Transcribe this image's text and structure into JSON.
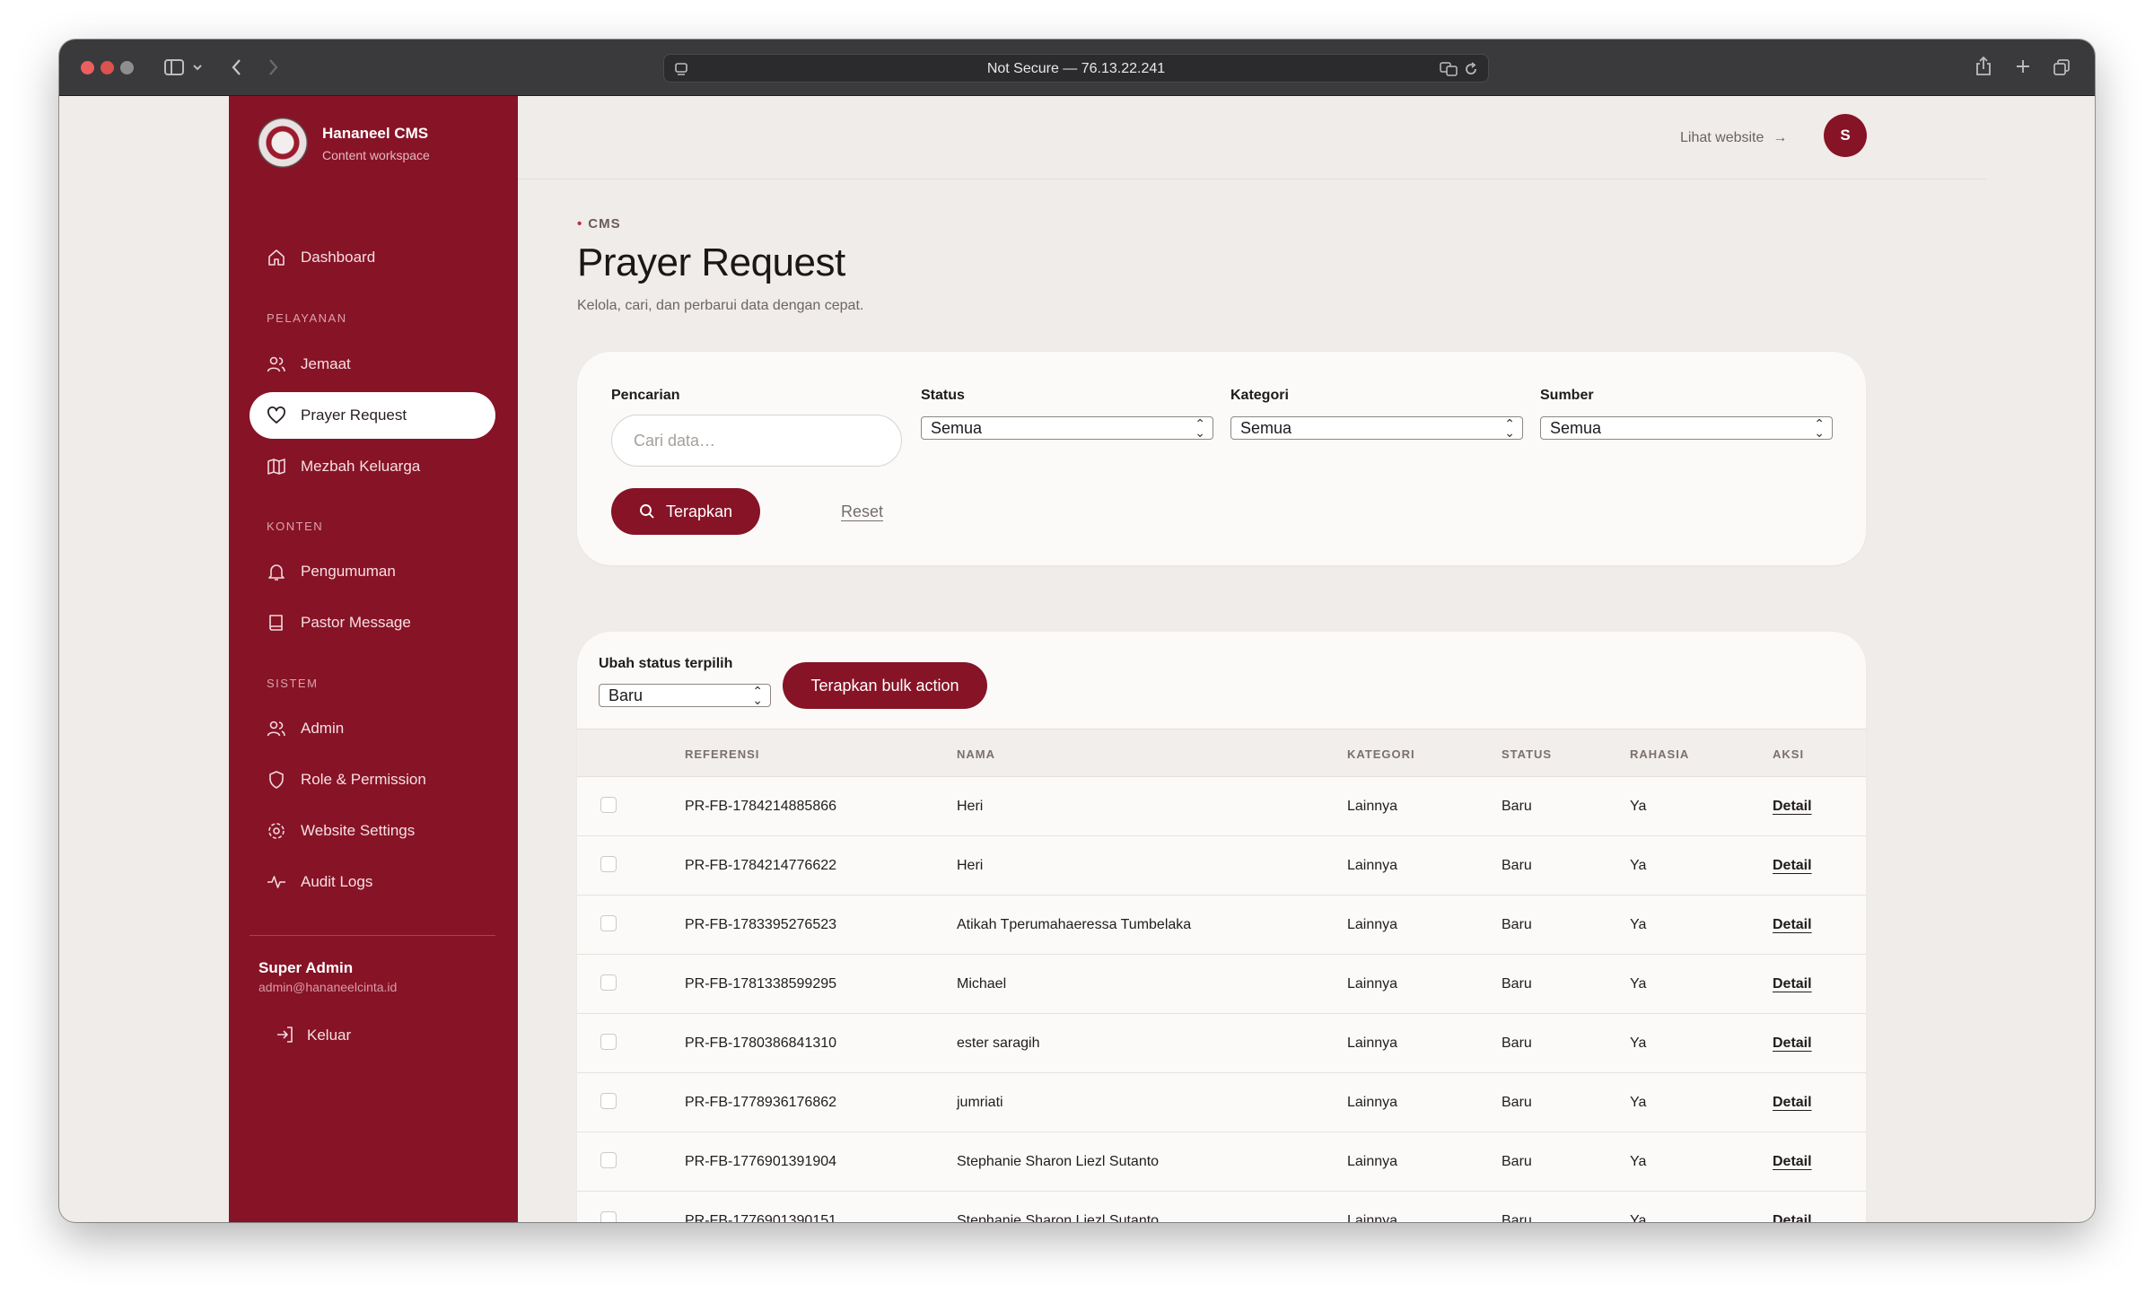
{
  "browser": {
    "url": "Not Secure — 76.13.22.241"
  },
  "brand": {
    "title": "Hananeel CMS",
    "subtitle": "Content workspace"
  },
  "sidebar": {
    "dashboard": "Dashboard",
    "sections": [
      "PELAYANAN",
      "KONTEN",
      "SISTEM"
    ],
    "items": [
      {
        "label": "Jemaat",
        "icon": "users-icon"
      },
      {
        "label": "Prayer Request",
        "icon": "heart-icon",
        "active": true
      },
      {
        "label": "Mezbah Keluarga",
        "icon": "map-icon"
      },
      {
        "label": "Pengumuman",
        "icon": "bell-icon"
      },
      {
        "label": "Pastor Message",
        "icon": "book-icon"
      },
      {
        "label": "Admin",
        "icon": "users-icon"
      },
      {
        "label": "Role & Permission",
        "icon": "shield-icon"
      },
      {
        "label": "Website Settings",
        "icon": "gear-icon"
      },
      {
        "label": "Audit Logs",
        "icon": "activity-icon"
      }
    ],
    "user": {
      "name": "Super Admin",
      "email": "admin@hananeelcinta.id"
    },
    "logout": "Keluar"
  },
  "topbar": {
    "view_site": "Lihat website",
    "avatar_initial": "S"
  },
  "page": {
    "breadcrumb": "CMS",
    "title": "Prayer Request",
    "description": "Kelola, cari, dan perbarui data dengan cepat."
  },
  "filters": {
    "search_label": "Pencarian",
    "search_placeholder": "Cari data…",
    "status_label": "Status",
    "status_value": "Semua",
    "category_label": "Kategori",
    "category_value": "Semua",
    "source_label": "Sumber",
    "source_value": "Semua",
    "apply": "Terapkan",
    "reset": "Reset"
  },
  "bulk": {
    "label": "Ubah status terpilih",
    "value": "Baru",
    "apply": "Terapkan bulk action"
  },
  "table": {
    "headers": [
      "REFERENSI",
      "NAMA",
      "KATEGORI",
      "STATUS",
      "RAHASIA",
      "AKSI"
    ],
    "rows": [
      {
        "ref": "PR-FB-1784214885866",
        "name": "Heri",
        "category": "Lainnya",
        "status": "Baru",
        "secret": "Ya",
        "action": "Detail"
      },
      {
        "ref": "PR-FB-1784214776622",
        "name": "Heri",
        "category": "Lainnya",
        "status": "Baru",
        "secret": "Ya",
        "action": "Detail"
      },
      {
        "ref": "PR-FB-1783395276523",
        "name": "Atikah Tperumahaeressa Tumbelaka",
        "category": "Lainnya",
        "status": "Baru",
        "secret": "Ya",
        "action": "Detail"
      },
      {
        "ref": "PR-FB-1781338599295",
        "name": "Michael",
        "category": "Lainnya",
        "status": "Baru",
        "secret": "Ya",
        "action": "Detail"
      },
      {
        "ref": "PR-FB-1780386841310",
        "name": "ester saragih",
        "category": "Lainnya",
        "status": "Baru",
        "secret": "Ya",
        "action": "Detail"
      },
      {
        "ref": "PR-FB-1778936176862",
        "name": "jumriati",
        "category": "Lainnya",
        "status": "Baru",
        "secret": "Ya",
        "action": "Detail"
      },
      {
        "ref": "PR-FB-1776901391904",
        "name": "Stephanie Sharon Liezl Sutanto",
        "category": "Lainnya",
        "status": "Baru",
        "secret": "Ya",
        "action": "Detail"
      },
      {
        "ref": "PR-FB-1776901390151",
        "name": "Stephanie Sharon Liezl Sutanto",
        "category": "Lainnya",
        "status": "Baru",
        "secret": "Ya",
        "action": "Detail"
      }
    ]
  },
  "colors": {
    "brand": "#871326",
    "background": "#efece9",
    "card": "#fbfaf9"
  }
}
